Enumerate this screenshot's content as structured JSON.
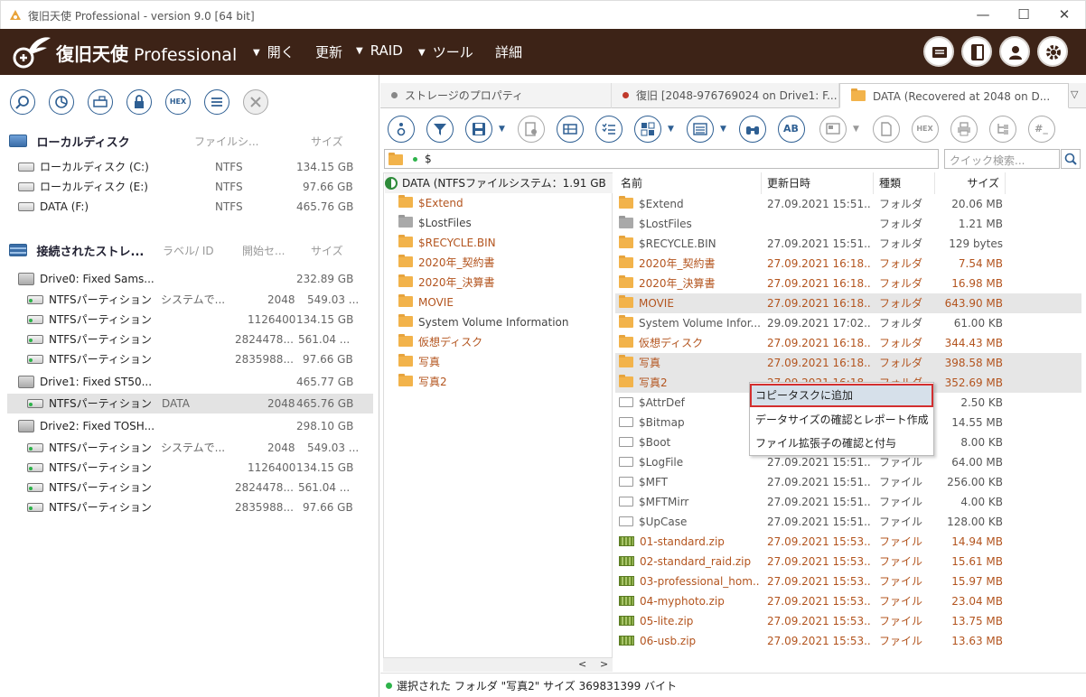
{
  "window": {
    "title": "復旧天使 Professional - version 9.0 [64 bit]"
  },
  "header": {
    "logo_jp": "復旧天使",
    "logo_en": "Professional",
    "menus": [
      "開く",
      "更新",
      "RAID",
      "ツール",
      "詳細"
    ]
  },
  "left": {
    "local_section": {
      "title": "ローカルディスク",
      "col_fs": "ファイルシ...",
      "col_size": "サイズ"
    },
    "local_disks": [
      {
        "name": "ローカルディスク (C:)",
        "fs": "NTFS",
        "size": "134.15 GB"
      },
      {
        "name": "ローカルディスク (E:)",
        "fs": "NTFS",
        "size": "97.66 GB"
      },
      {
        "name": "DATA (F:)",
        "fs": "NTFS",
        "size": "465.76 GB"
      }
    ],
    "storage_section": {
      "title": "接続されたストレ...",
      "col_label": "ラベル/ ID",
      "col_start": "開始セ...",
      "col_size": "サイズ"
    },
    "drives": [
      {
        "name": "Drive0: Fixed Sams...",
        "size": "232.89 GB",
        "partitions": [
          {
            "name": "NTFSパーティション",
            "label": "システムで...",
            "start": "2048",
            "size": "549.03 ..."
          },
          {
            "name": "NTFSパーティション",
            "label": "",
            "start": "1126400",
            "size": "134.15 GB"
          },
          {
            "name": "NTFSパーティション",
            "label": "",
            "start": "2824478...",
            "size": "561.04 ..."
          },
          {
            "name": "NTFSパーティション",
            "label": "",
            "start": "2835988...",
            "size": "97.66 GB"
          }
        ]
      },
      {
        "name": "Drive1: Fixed ST50...",
        "size": "465.77 GB",
        "partitions": [
          {
            "name": "NTFSパーティション",
            "label": "DATA",
            "start": "2048",
            "size": "465.76 GB"
          }
        ]
      },
      {
        "name": "Drive2: Fixed TOSH...",
        "size": "298.10 GB",
        "partitions": [
          {
            "name": "NTFSパーティション",
            "label": "システムで...",
            "start": "2048",
            "size": "549.03 ..."
          },
          {
            "name": "NTFSパーティション",
            "label": "",
            "start": "1126400",
            "size": "134.15 GB"
          },
          {
            "name": "NTFSパーティション",
            "label": "",
            "start": "2824478...",
            "size": "561.04 ..."
          },
          {
            "name": "NTFSパーティション",
            "label": "",
            "start": "2835988...",
            "size": "97.66 GB"
          }
        ]
      }
    ],
    "toolbar_hex": "HEX"
  },
  "tabs": [
    {
      "label": "ストレージのプロパティ",
      "dot_color": "#888888"
    },
    {
      "label": "復旧 [2048-976769024 on Drive1: F...",
      "dot_color": "#c0392b"
    },
    {
      "label": "DATA (Recovered at 2048 on D...",
      "dot_color": ""
    }
  ],
  "toolbar2": {
    "ab": "AB",
    "hex": "HEX",
    "hash": "#_"
  },
  "path": {
    "value": "$",
    "search_placeholder": "クイック検索..."
  },
  "tree": {
    "root": "DATA (NTFSファイルシステム：1.91 GB",
    "items": [
      {
        "name": "$Extend",
        "color": "orange",
        "gray": false
      },
      {
        "name": "$LostFiles",
        "color": "dark",
        "gray": true
      },
      {
        "name": "$RECYCLE.BIN",
        "color": "orange",
        "gray": false
      },
      {
        "name": "2020年_契約書",
        "color": "orange",
        "gray": false
      },
      {
        "name": "2020年_決算書",
        "color": "orange",
        "gray": false
      },
      {
        "name": "MOVIE",
        "color": "orange",
        "gray": false
      },
      {
        "name": "System Volume Information",
        "color": "dark",
        "gray": false
      },
      {
        "name": "仮想ディスク",
        "color": "orange",
        "gray": false
      },
      {
        "name": "写真",
        "color": "orange",
        "gray": false
      },
      {
        "name": "写真2",
        "color": "orange",
        "gray": false
      }
    ]
  },
  "list": {
    "headers": [
      "名前",
      "更新日時",
      "種類",
      "サイズ"
    ],
    "rows": [
      {
        "icon": "folder",
        "name": "$Extend",
        "date": "27.09.2021 15:51...",
        "type": "フォルダ",
        "size": "20.06 MB",
        "color": "dark",
        "hl": false
      },
      {
        "icon": "folder-gray",
        "name": "$LostFiles",
        "date": "",
        "type": "フォルダ",
        "size": "1.21 MB",
        "color": "dark",
        "hl": false
      },
      {
        "icon": "folder",
        "name": "$RECYCLE.BIN",
        "date": "27.09.2021 15:51...",
        "type": "フォルダ",
        "size": "129 bytes",
        "color": "dark",
        "hl": false
      },
      {
        "icon": "folder",
        "name": "2020年_契約書",
        "date": "27.09.2021 16:18...",
        "type": "フォルダ",
        "size": "7.54 MB",
        "color": "orange",
        "hl": false
      },
      {
        "icon": "folder",
        "name": "2020年_決算書",
        "date": "27.09.2021 16:18...",
        "type": "フォルダ",
        "size": "16.98 MB",
        "color": "orange",
        "hl": false
      },
      {
        "icon": "folder",
        "name": "MOVIE",
        "date": "27.09.2021 16:18...",
        "type": "フォルダ",
        "size": "643.90 MB",
        "color": "orange",
        "hl": true
      },
      {
        "icon": "folder",
        "name": "System Volume Infor...",
        "date": "29.09.2021 17:02...",
        "type": "フォルダ",
        "size": "61.00 KB",
        "color": "dark",
        "hl": false
      },
      {
        "icon": "folder",
        "name": "仮想ディスク",
        "date": "27.09.2021 16:18...",
        "type": "フォルダ",
        "size": "344.43 MB",
        "color": "orange",
        "hl": false
      },
      {
        "icon": "folder",
        "name": "写真",
        "date": "27.09.2021 16:18...",
        "type": "フォルダ",
        "size": "398.58 MB",
        "color": "orange",
        "hl": true
      },
      {
        "icon": "folder",
        "name": "写真2",
        "date": "27.09.2021 16:18...",
        "type": "フォルダ",
        "size": "352.69 MB",
        "color": "orange",
        "hl": true
      },
      {
        "icon": "file",
        "name": "$AttrDef",
        "date": "",
        "type": "",
        "size": "2.50 KB",
        "color": "dark",
        "hl": false
      },
      {
        "icon": "file",
        "name": "$Bitmap",
        "date": "",
        "type": "",
        "size": "14.55 MB",
        "color": "dark",
        "hl": false
      },
      {
        "icon": "file",
        "name": "$Boot",
        "date": "",
        "type": "",
        "size": "8.00 KB",
        "color": "dark",
        "hl": false
      },
      {
        "icon": "file",
        "name": "$LogFile",
        "date": "27.09.2021 15:51...",
        "type": "ファイル",
        "size": "64.00 MB",
        "color": "dark",
        "hl": false
      },
      {
        "icon": "file",
        "name": "$MFT",
        "date": "27.09.2021 15:51...",
        "type": "ファイル",
        "size": "256.00 KB",
        "color": "dark",
        "hl": false
      },
      {
        "icon": "file",
        "name": "$MFTMirr",
        "date": "27.09.2021 15:51...",
        "type": "ファイル",
        "size": "4.00 KB",
        "color": "dark",
        "hl": false
      },
      {
        "icon": "file",
        "name": "$UpCase",
        "date": "27.09.2021 15:51...",
        "type": "ファイル",
        "size": "128.00 KB",
        "color": "dark",
        "hl": false
      },
      {
        "icon": "zip",
        "name": "01-standard.zip",
        "date": "27.09.2021 15:53...",
        "type": "ファイル",
        "size": "14.94 MB",
        "color": "orange",
        "hl": false
      },
      {
        "icon": "zip",
        "name": "02-standard_raid.zip",
        "date": "27.09.2021 15:53...",
        "type": "ファイル",
        "size": "15.61 MB",
        "color": "orange",
        "hl": false
      },
      {
        "icon": "zip",
        "name": "03-professional_hom...",
        "date": "27.09.2021 15:53...",
        "type": "ファイル",
        "size": "15.97 MB",
        "color": "orange",
        "hl": false
      },
      {
        "icon": "zip",
        "name": "04-myphoto.zip",
        "date": "27.09.2021 15:53...",
        "type": "ファイル",
        "size": "23.04 MB",
        "color": "orange",
        "hl": false
      },
      {
        "icon": "zip",
        "name": "05-lite.zip",
        "date": "27.09.2021 15:53...",
        "type": "ファイル",
        "size": "13.75 MB",
        "color": "orange",
        "hl": false
      },
      {
        "icon": "zip",
        "name": "06-usb.zip",
        "date": "27.09.2021 15:53...",
        "type": "ファイル",
        "size": "13.63 MB",
        "color": "orange",
        "hl": false
      }
    ]
  },
  "context_menu": {
    "items": [
      "コピータスクに追加",
      "データサイズの確認とレポート作成",
      "ファイル拡張子の確認と付与"
    ]
  },
  "status": {
    "text": "選択された フォルダ \"写真2\" サイズ 369831399 バイト"
  },
  "colors": {
    "header_bg": "#3d2317",
    "accent_blue": "#2e5f93",
    "orange_text": "#b3541e",
    "highlight_red": "#d32f2f"
  }
}
